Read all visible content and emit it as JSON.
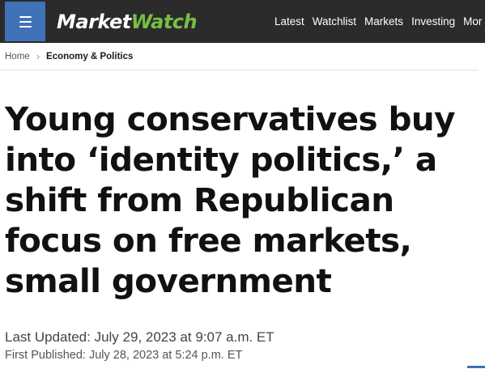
{
  "header": {
    "logo_part1": "Market",
    "logo_part2": "Watch",
    "nav": [
      "Latest",
      "Watchlist",
      "Markets",
      "Investing",
      "Mor"
    ]
  },
  "breadcrumb": {
    "home": "Home",
    "separator": "›",
    "section": "Economy & Politics"
  },
  "article": {
    "headline": "Young conservatives buy into ‘identity politics,’ a shift from Republican focus on free markets, small government",
    "last_updated": "Last Updated: July 29, 2023 at 9:07 a.m. ET",
    "first_published": "First Published: July 28, 2023 at 5:24 p.m. ET"
  },
  "colors": {
    "header_bg": "#2b2b2b",
    "menu_button": "#3f72b6",
    "logo_accent": "#76bf43"
  }
}
